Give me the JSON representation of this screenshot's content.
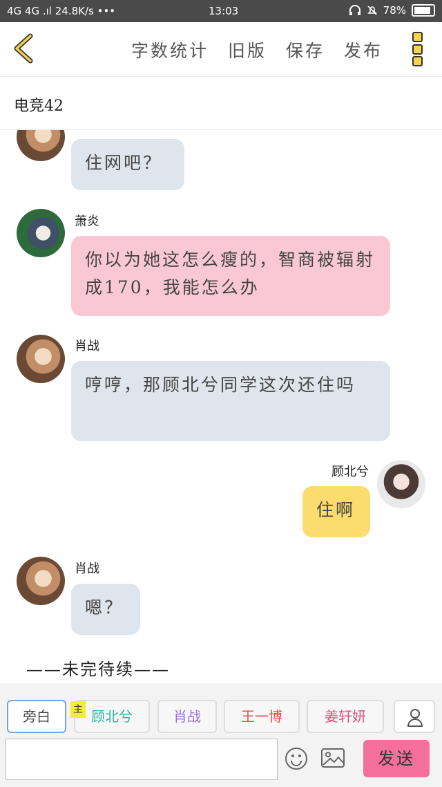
{
  "status_bar": {
    "left": "4G 4G .ıl 24.8K/s •••",
    "time": "13:03",
    "battery": "78%"
  },
  "toolbar": {
    "back_icon": "chevron-left-icon",
    "actions": [
      "字数统计",
      "旧版",
      "保存",
      "发布"
    ],
    "menu_icon": "menu-dots-icon"
  },
  "title": "电竞42",
  "messages": [
    {
      "speaker": "",
      "text": "住网吧？",
      "side": "left",
      "style": "grey"
    },
    {
      "speaker": "萧炎",
      "text": "你以为她这怎么瘦的，智商被辐射成170，我能怎么办",
      "side": "left",
      "style": "pink"
    },
    {
      "speaker": "肖战",
      "text": "哼哼，那顾北兮同学这次还住吗",
      "side": "left",
      "style": "grey"
    },
    {
      "speaker": "顾北兮",
      "text": "住啊",
      "side": "right",
      "style": "yellow"
    },
    {
      "speaker": "肖战",
      "text": "嗯？",
      "side": "left",
      "style": "grey"
    }
  ],
  "to_be_continued": "——未完待续——",
  "characters": [
    {
      "label": "旁白",
      "color": "#444444"
    },
    {
      "label": "顾北兮",
      "color": "#2bb3a6",
      "badge": "主"
    },
    {
      "label": "肖战",
      "color": "#9b6fcf"
    },
    {
      "label": "王一博",
      "color": "#e0504a"
    },
    {
      "label": "姜轩妍",
      "color": "#e0507a"
    }
  ],
  "input": {
    "placeholder": "",
    "value": ""
  },
  "send_label": "发送",
  "colors": {
    "accent_send": "#f56f9c",
    "bubble_grey": "#dfe5ec",
    "bubble_pink": "#fac8d5",
    "bubble_yellow": "#fcdc6f"
  }
}
